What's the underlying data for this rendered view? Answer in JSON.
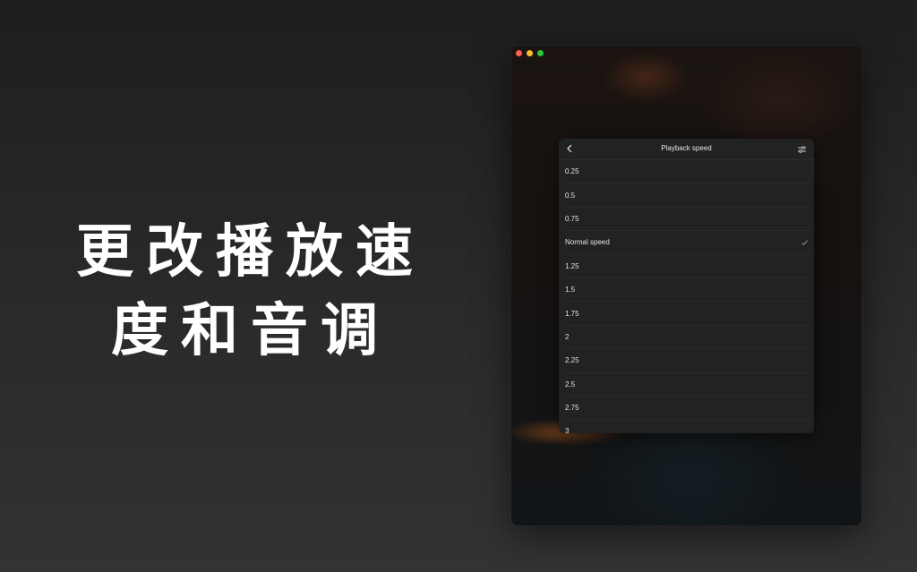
{
  "headline": {
    "line1": "更改播放速",
    "line2": "度和音调"
  },
  "window": {
    "traffic_lights": [
      "close",
      "minimize",
      "zoom"
    ]
  },
  "panel": {
    "title": "Playback speed",
    "back_icon": "chevron-left-icon",
    "settings_icon": "sliders-icon",
    "selected": "Normal speed",
    "options": [
      {
        "label": "0.25"
      },
      {
        "label": "0.5"
      },
      {
        "label": "0.75"
      },
      {
        "label": "Normal speed"
      },
      {
        "label": "1.25"
      },
      {
        "label": "1.5"
      },
      {
        "label": "1.75"
      },
      {
        "label": "2"
      },
      {
        "label": "2.25"
      },
      {
        "label": "2.5"
      },
      {
        "label": "2.75"
      },
      {
        "label": "3"
      }
    ]
  },
  "colors": {
    "background_top": "#1e1e1e",
    "background_bottom": "#333333",
    "panel_bg": "#222222",
    "text": "#e2e2e2",
    "headline": "#ffffff"
  }
}
